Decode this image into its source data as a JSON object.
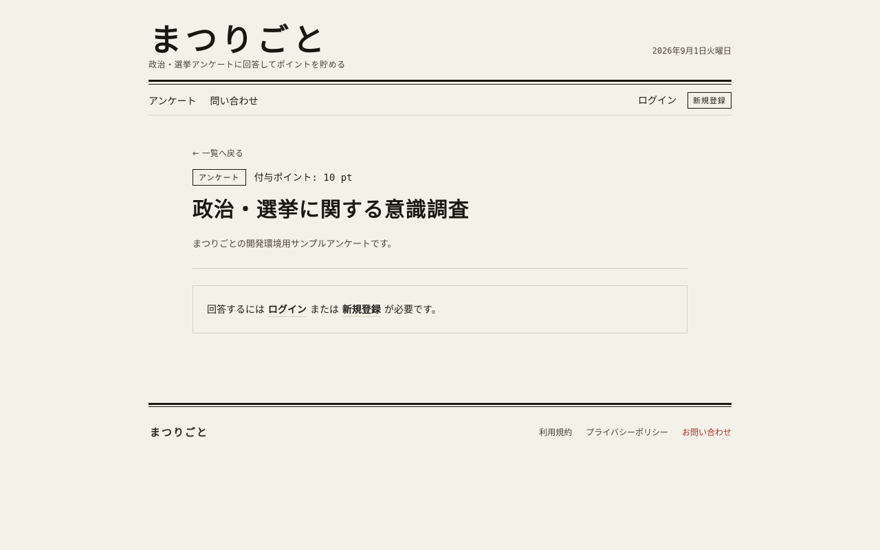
{
  "header": {
    "site_title": "まつりごと",
    "tagline": "政治・選挙アンケートに回答してポイントを貯める",
    "date": "2026年9月1日火曜日"
  },
  "nav": {
    "left_items": [
      "アンケート",
      "問い合わせ"
    ],
    "login_label": "ログイン",
    "register_label": "新規登録"
  },
  "main": {
    "back_label": "← 一覧へ戻る",
    "category_badge": "アンケート",
    "points_text": "付与ポイント: 10 pt",
    "title": "政治・選挙に関する意識調査",
    "description": "まつりごとの開発環境用サンプルアンケートです。",
    "notice": {
      "prefix": "回答するには",
      "login_link": "ログイン",
      "middle": "または",
      "register_link": "新規登録",
      "suffix": "が必要です。"
    }
  },
  "footer": {
    "logo": "まつりごと",
    "links": {
      "terms": "利用規約",
      "privacy": "プライバシーポリシー",
      "contact": "お問い合わせ"
    }
  },
  "colors": {
    "background": "#f4f1e8",
    "text": "#1f1b16",
    "muted": "#4a443b",
    "rule": "#1a1611",
    "light_rule": "#d6d0bf",
    "accent": "#a8322a"
  }
}
